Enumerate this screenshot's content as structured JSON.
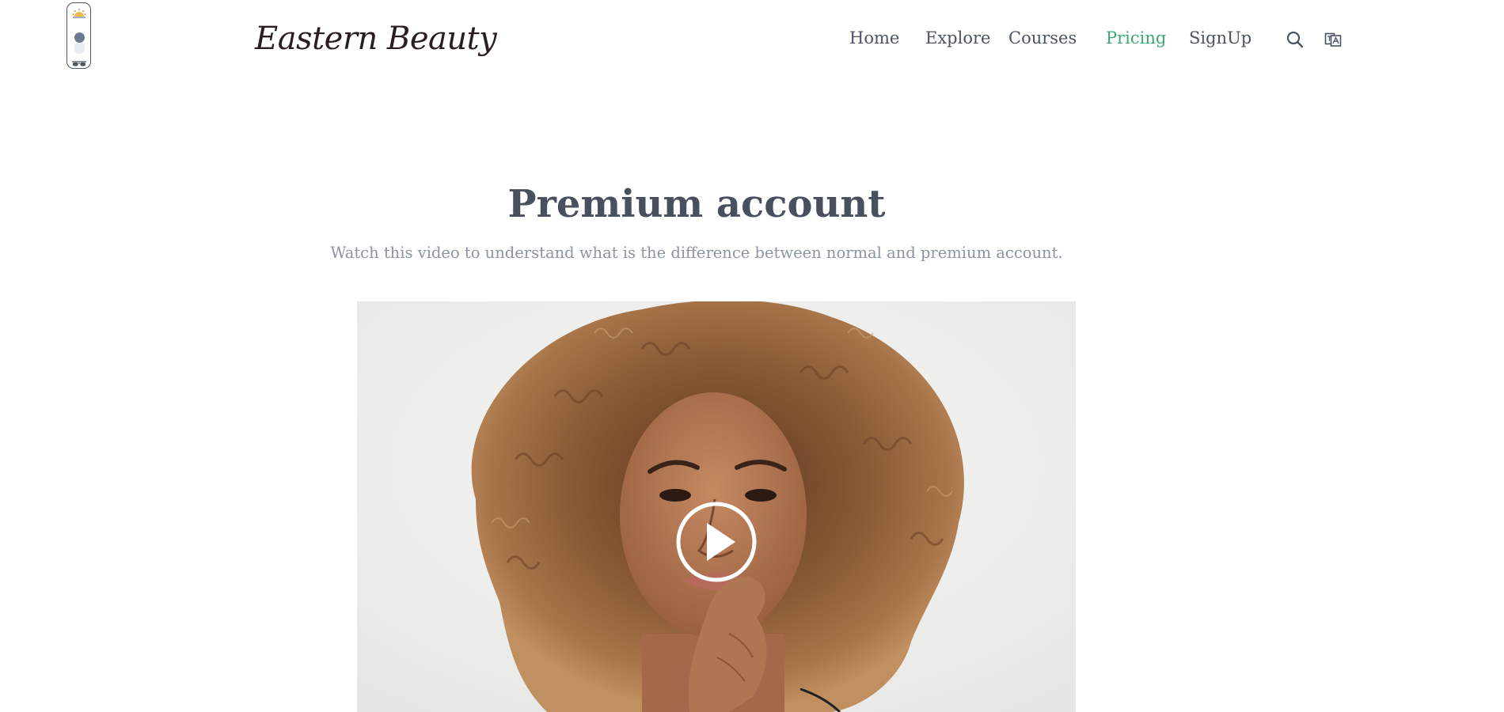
{
  "header": {
    "brand": "Eastern Beauty",
    "nav": [
      {
        "label": "Home"
      },
      {
        "label": "Explore"
      },
      {
        "label": "Courses"
      },
      {
        "label": "Pricing",
        "active": true
      },
      {
        "label": "SignUp"
      }
    ],
    "icons": [
      "search-icon",
      "translate-icon"
    ],
    "theme_toggle_icons": [
      "sun-icon",
      "sunglasses-icon"
    ]
  },
  "main": {
    "title": "Premium account",
    "subtitle": "Watch this video to understand what is the difference between normal and premium account."
  },
  "video": {
    "play_icon": "play-icon"
  },
  "colors": {
    "accent": "#3aa872",
    "nav_text": "#4a5362",
    "title": "#47505c",
    "subtitle": "#8a94a6"
  }
}
